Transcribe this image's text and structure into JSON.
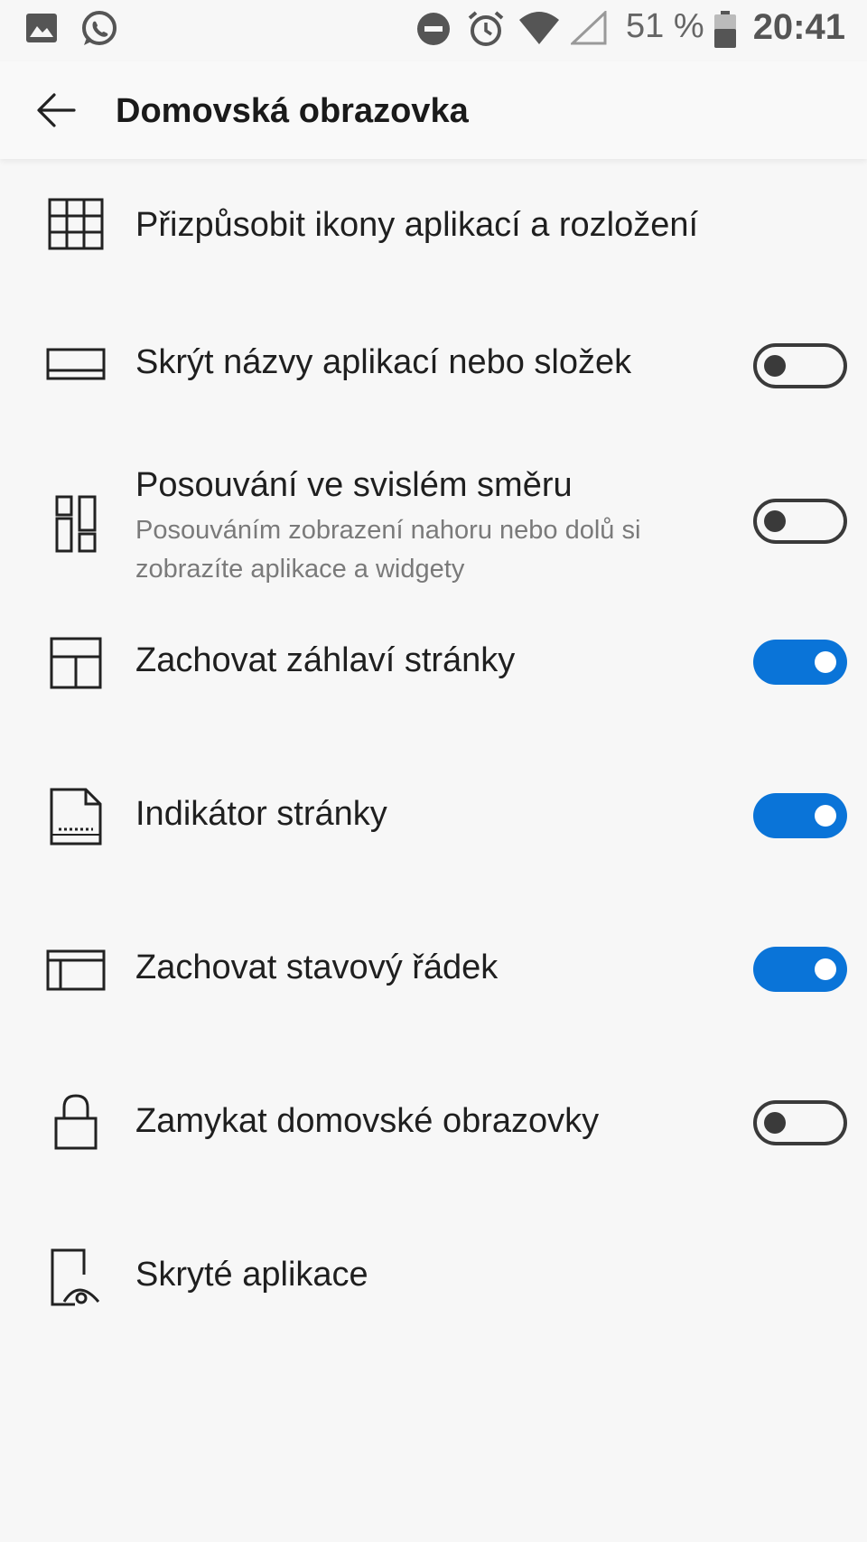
{
  "status_bar": {
    "battery_percent": "51 %",
    "time": "20:41",
    "icons": [
      "gallery-icon",
      "whatsapp-icon",
      "do-not-disturb-icon",
      "alarm-icon",
      "wifi-icon",
      "cellular-signal-icon",
      "battery-icon"
    ]
  },
  "header": {
    "title": "Domovská obrazovka",
    "back_icon": "back-arrow-icon"
  },
  "settings": [
    {
      "label": "Přizpůsobit ikony aplikací a rozložení",
      "icon": "grid-icon"
    },
    {
      "label": "Skrýt názvy aplikací nebo složek",
      "icon": "label-bar-icon",
      "toggle": false
    },
    {
      "label": "Posouvání ve svislém směru",
      "description": "Posouváním zobrazení nahoru nebo dolů si zobrazíte aplikace a widgety",
      "icon": "vertical-layout-icon",
      "toggle": false
    },
    {
      "label": "Zachovat záhlaví stránky",
      "icon": "page-header-icon",
      "toggle": true
    },
    {
      "label": "Indikátor stránky",
      "icon": "page-indicator-icon",
      "toggle": true
    },
    {
      "label": "Zachovat stavový řádek",
      "icon": "status-bar-icon",
      "toggle": true
    },
    {
      "label": "Zamykat domovské obrazovky",
      "icon": "lock-icon",
      "toggle": false
    },
    {
      "label": "Skryté aplikace",
      "icon": "hidden-apps-icon"
    }
  ],
  "colors": {
    "accent": "#0a74d8",
    "background": "#f7f7f7",
    "toggle_off": "#3a3a3a"
  }
}
